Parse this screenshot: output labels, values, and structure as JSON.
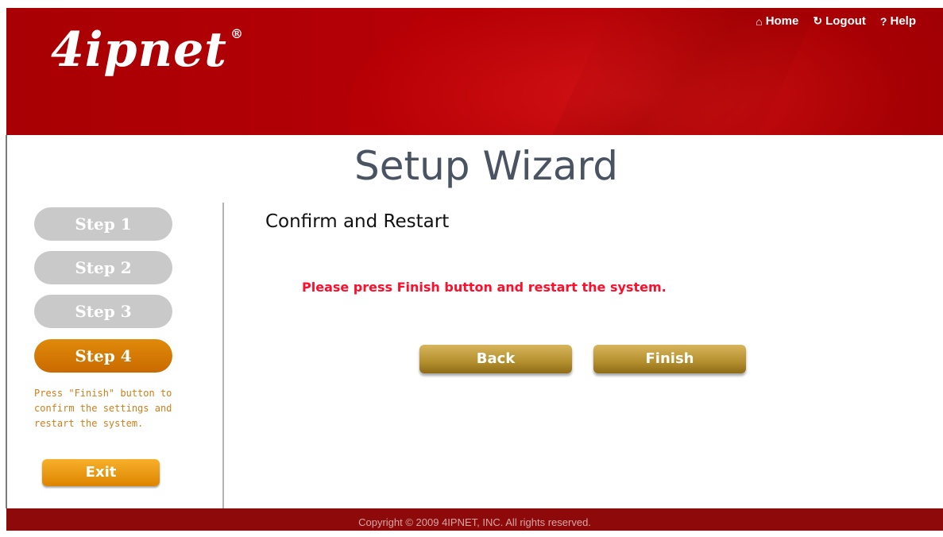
{
  "header": {
    "logo_text": "4ipnet",
    "logo_mark": "®",
    "nav": [
      {
        "label": "Home",
        "icon": "home-icon",
        "glyph": "⌂"
      },
      {
        "label": "Logout",
        "icon": "logout-icon",
        "glyph": "↻"
      },
      {
        "label": "Help",
        "icon": "help-icon",
        "glyph": "?"
      }
    ]
  },
  "page": {
    "title": "Setup Wizard"
  },
  "steps": [
    {
      "label": "Step 1",
      "state": "inactive"
    },
    {
      "label": "Step 2",
      "state": "inactive"
    },
    {
      "label": "Step 3",
      "state": "inactive"
    },
    {
      "label": "Step 4",
      "state": "active"
    }
  ],
  "sidebar": {
    "description_lines": [
      "Press \"Finish\" button to",
      "confirm the settings and",
      "restart the system."
    ],
    "exit_label": "Exit"
  },
  "main": {
    "section_title": "Confirm and Restart",
    "message": "Please press Finish button and restart the system.",
    "back_label": "Back",
    "finish_label": "Finish"
  },
  "footer": {
    "copyright": "Copyright © 2009 4IPNET, INC. All rights reserved."
  },
  "colors": {
    "brand_red": "#a80004",
    "active_step": "#d97800",
    "inactive_step": "#c9c9c9",
    "message_red": "#ff0d2a",
    "button_gold": "#b38f2d"
  }
}
